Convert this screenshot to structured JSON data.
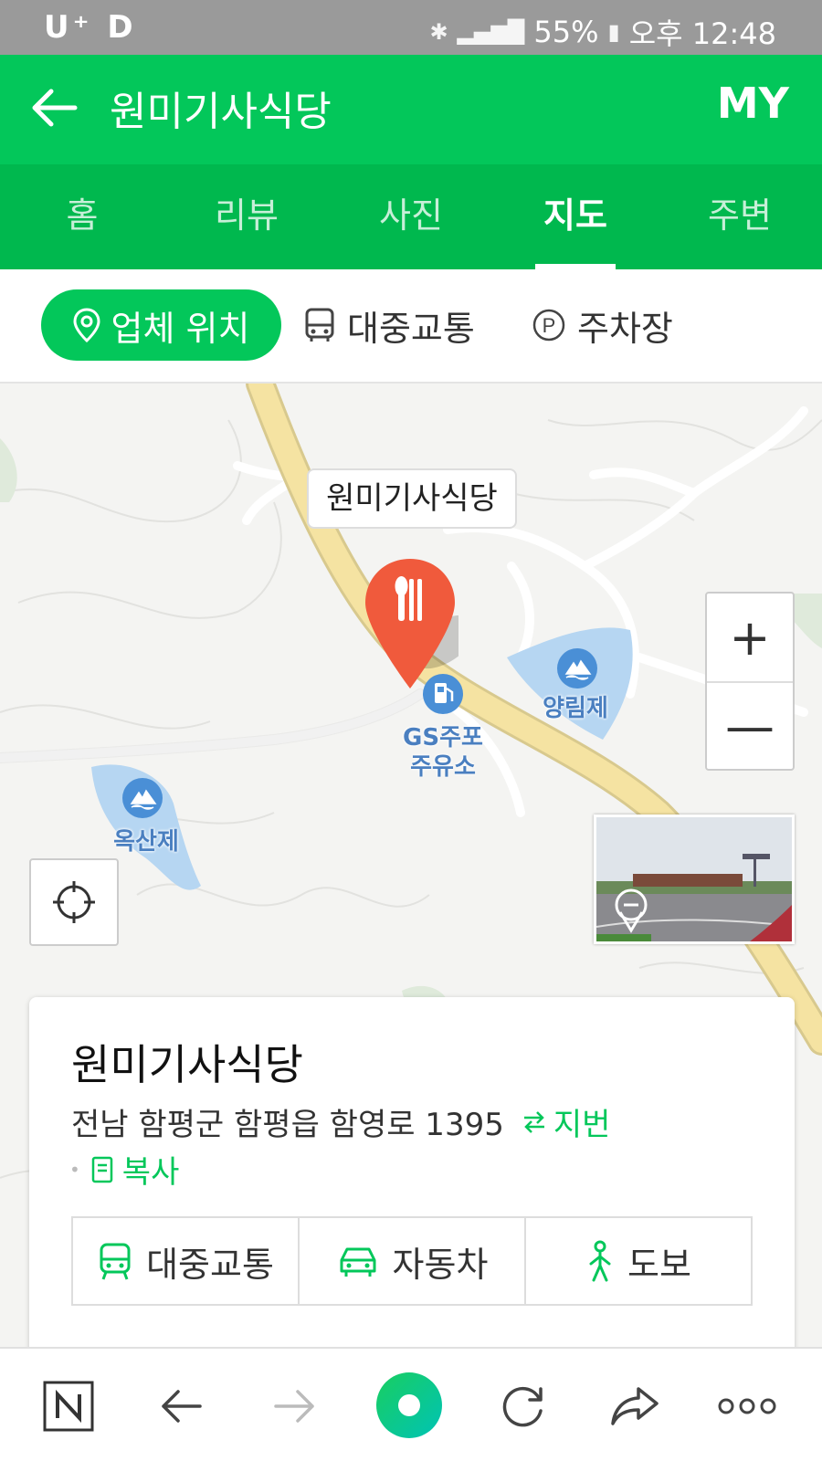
{
  "status_bar": {
    "carrier": "U⁺ D",
    "battery": "55%",
    "time": "오후 12:48"
  },
  "header": {
    "title": "원미기사식당",
    "my_label": "MY"
  },
  "tabs": [
    {
      "label": "홈",
      "active": false
    },
    {
      "label": "리뷰",
      "active": false
    },
    {
      "label": "사진",
      "active": false
    },
    {
      "label": "지도",
      "active": true
    },
    {
      "label": "주변",
      "active": false
    }
  ],
  "sub_tabs": {
    "location": "업체 위치",
    "transit": "대중교통",
    "parking": "주차장"
  },
  "map": {
    "callout": "원미기사식당",
    "gas_station": "GS주포\n주유소",
    "reservoir_1": "양림제",
    "reservoir_2": "옥산제",
    "zoom_in": "+",
    "zoom_out": "—"
  },
  "card": {
    "title": "원미기사식당",
    "address": "전남 함평군 함평읍 함영로 1395",
    "lot_number_link": "지번",
    "copy_link": "복사",
    "routes": {
      "transit": "대중교통",
      "car": "자동차",
      "walk": "도보"
    }
  },
  "colors": {
    "brand_green": "#03c75a",
    "tab_green": "#00b84e",
    "pin_red": "#f05a3c"
  }
}
